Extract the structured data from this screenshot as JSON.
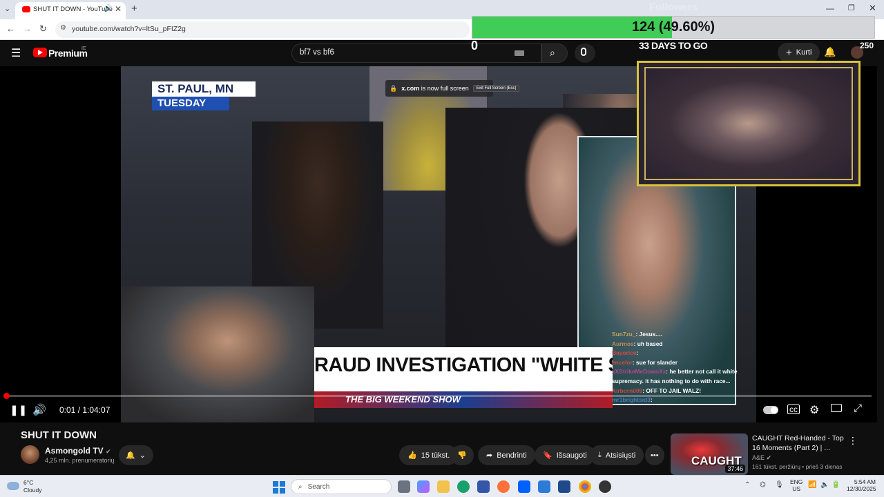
{
  "browser": {
    "tab_title": "SHUT IT DOWN - YouTube",
    "url": "youtube.com/watch?v=ltSu_pFIZ2g"
  },
  "youtube": {
    "logo_text": "Premium",
    "logo_region": "IE",
    "search_value": "bf7 vs bf6",
    "create_label": "Kurti"
  },
  "overlay": {
    "followers_label": "Followers",
    "followers_text": "124 (49.60%)",
    "followers_progress": 0.496,
    "counter": "0",
    "days_to_go": "33 DAYS TO GO",
    "goal_count": "250"
  },
  "video": {
    "location_line1": "ST. PAUL, MN",
    "location_line2": "TUESDAY",
    "fullscreen_domain": "x.com",
    "fullscreen_text": "is now full screen",
    "fullscreen_exit": "Exit Full Screen (Esc)",
    "chyron": "RAUD INVESTIGATION \"WHITE SUPREMACY\"",
    "chyron_strip": "THE BIG WEEKEND SHOW",
    "time_display": "0:01 / 1:04:07",
    "progress": 0.0003,
    "chat": [
      {
        "user": "Sun7zu_",
        "msg": ": Jesus....",
        "color": "#c0a25a"
      },
      {
        "user": "Aurmos",
        "msg": ": uh based",
        "color": "#c08a5a"
      },
      {
        "user": "Bayorice",
        "msg": ":",
        "color": "#d04a4a"
      },
      {
        "user": "encelor",
        "msg": ": sue for slander",
        "color": "#d04a4a"
      },
      {
        "user": "xXStrikeMeDownXx",
        "msg": ": he better not call it white",
        "color": "#b0478f"
      },
      {
        "user": "",
        "msg": "supremacy. it has nothing to do with race...",
        "color": "#fff"
      },
      {
        "user": "Airborn009",
        "msg": ": OFF TO JAIL WALZ!",
        "color": "#c04a4a"
      },
      {
        "user": "mr1brightsid3",
        "msg": ":",
        "color": "#4a7ac0"
      }
    ]
  },
  "below": {
    "title": "SHUT IT DOWN",
    "channel": "Asmongold TV",
    "subscribers": "4,25 mln. prenumeratorių",
    "likes": "15 tūkst.",
    "share": "Bendrinti",
    "save": "Išsaugoti",
    "download": "Atsisiųsti"
  },
  "recommended": {
    "title": "CAUGHT Red-Handed - Top 16 Moments (Part 2) | ...",
    "channel": "A&E",
    "stats": "161 tūkst. peržiūrų • prieš 3 dienas",
    "duration": "37:46",
    "thumb_text": "CAUGHT"
  },
  "taskbar": {
    "temp": "6°C",
    "weather": "Cloudy",
    "search": "Search",
    "lang1": "ENG",
    "lang2": "US",
    "time": "5:54 AM",
    "date": "12/30/2025"
  }
}
